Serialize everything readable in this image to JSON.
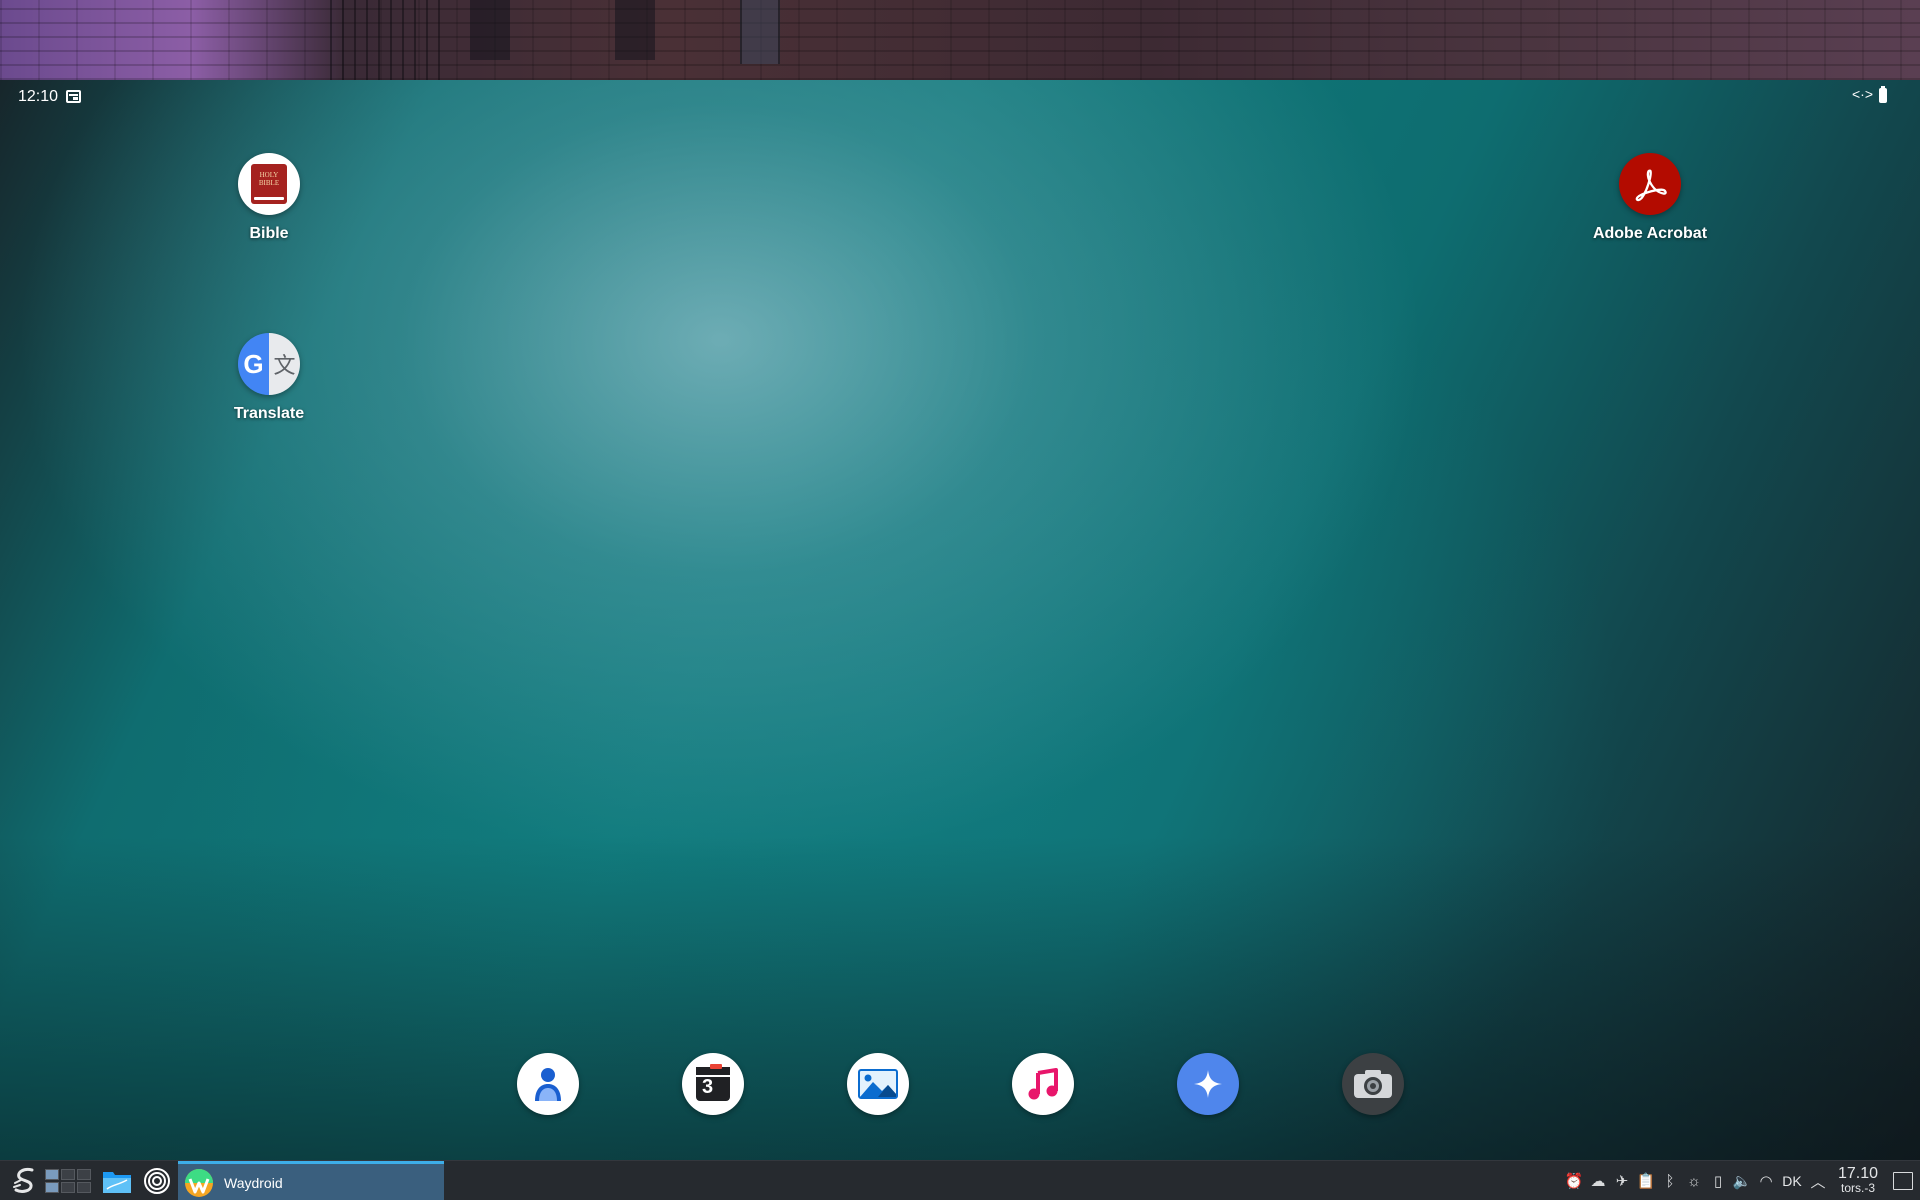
{
  "android": {
    "status_time": "12:10",
    "desktop_apps": [
      {
        "label": "Bible",
        "icon": "bible-icon",
        "icon_text": "HOLY BIBLE"
      },
      {
        "label": "Translate",
        "icon": "translate-icon",
        "icon_g": "G",
        "icon_x": "文"
      },
      {
        "label": "Adobe Acrobat",
        "icon": "adobe-acrobat-icon"
      }
    ],
    "dock": [
      {
        "name": "contacts-icon"
      },
      {
        "name": "calendar-icon",
        "text": "3"
      },
      {
        "name": "gallery-icon"
      },
      {
        "name": "music-icon"
      },
      {
        "name": "assistant-icon"
      },
      {
        "name": "camera-icon"
      }
    ],
    "colors": {
      "acrobat": "#b30b00",
      "assistant": "#4f86ec",
      "accent": "#3daee9"
    }
  },
  "taskbar": {
    "task_label": "Waydroid",
    "tray": {
      "language": "DK",
      "clock_time": "17.10",
      "clock_date": "tors.-3"
    }
  }
}
